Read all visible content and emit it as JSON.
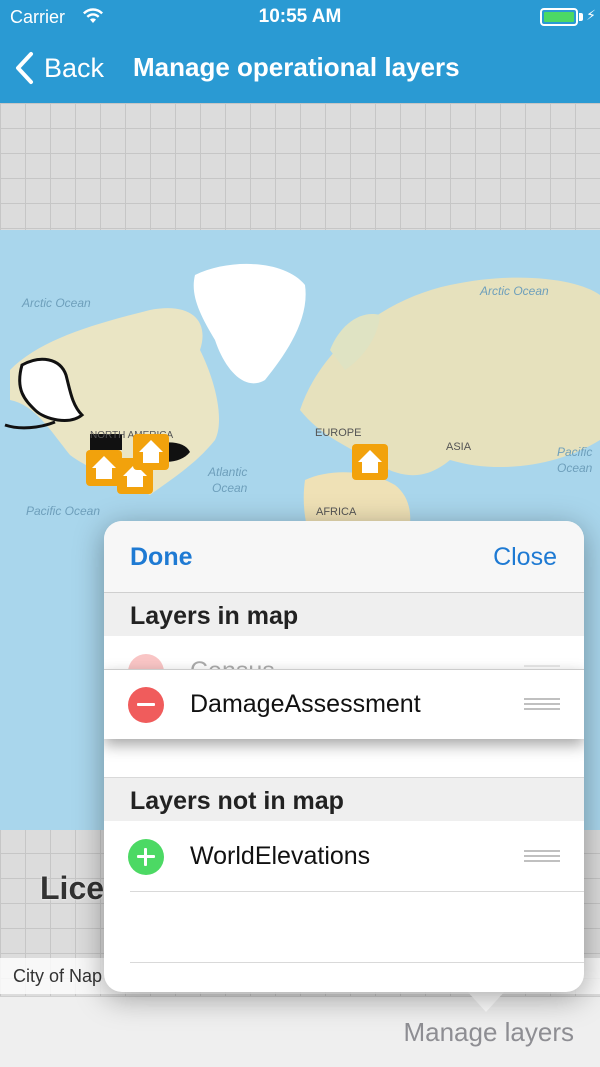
{
  "status_bar": {
    "carrier": "Carrier",
    "time": "10:55 AM"
  },
  "nav": {
    "back_label": "Back",
    "title": "Manage operational layers"
  },
  "map": {
    "labels": {
      "arctic_west": "Arctic Ocean",
      "arctic_east": "Arctic Ocean",
      "north_america": "NORTH AMERICA",
      "europe": "EUROPE",
      "asia": "ASIA",
      "atlantic": "Atlantic",
      "atlantic2": "Ocean",
      "pacific_west": "Pacific Ocean",
      "pacific_east": "Pacific",
      "pacific_east2": "Ocean",
      "africa": "AFRICA"
    },
    "license_text": "Lice",
    "attribution": "City of Nap"
  },
  "popover": {
    "done_label": "Done",
    "close_label": "Close",
    "section_in_map": "Layers in map",
    "section_not_in_map": "Layers not in map",
    "layers_in_map": [
      "Census",
      "DamageAssessment"
    ],
    "layers_not_in_map": [
      "WorldElevations"
    ]
  },
  "toolbar": {
    "manage_layers_label": "Manage layers"
  },
  "colors": {
    "nav_bar": "#2a9ad3",
    "accent": "#1e7ad3",
    "remove": "#f05c5c",
    "add": "#4cd964",
    "marker": "#f2a20c"
  }
}
